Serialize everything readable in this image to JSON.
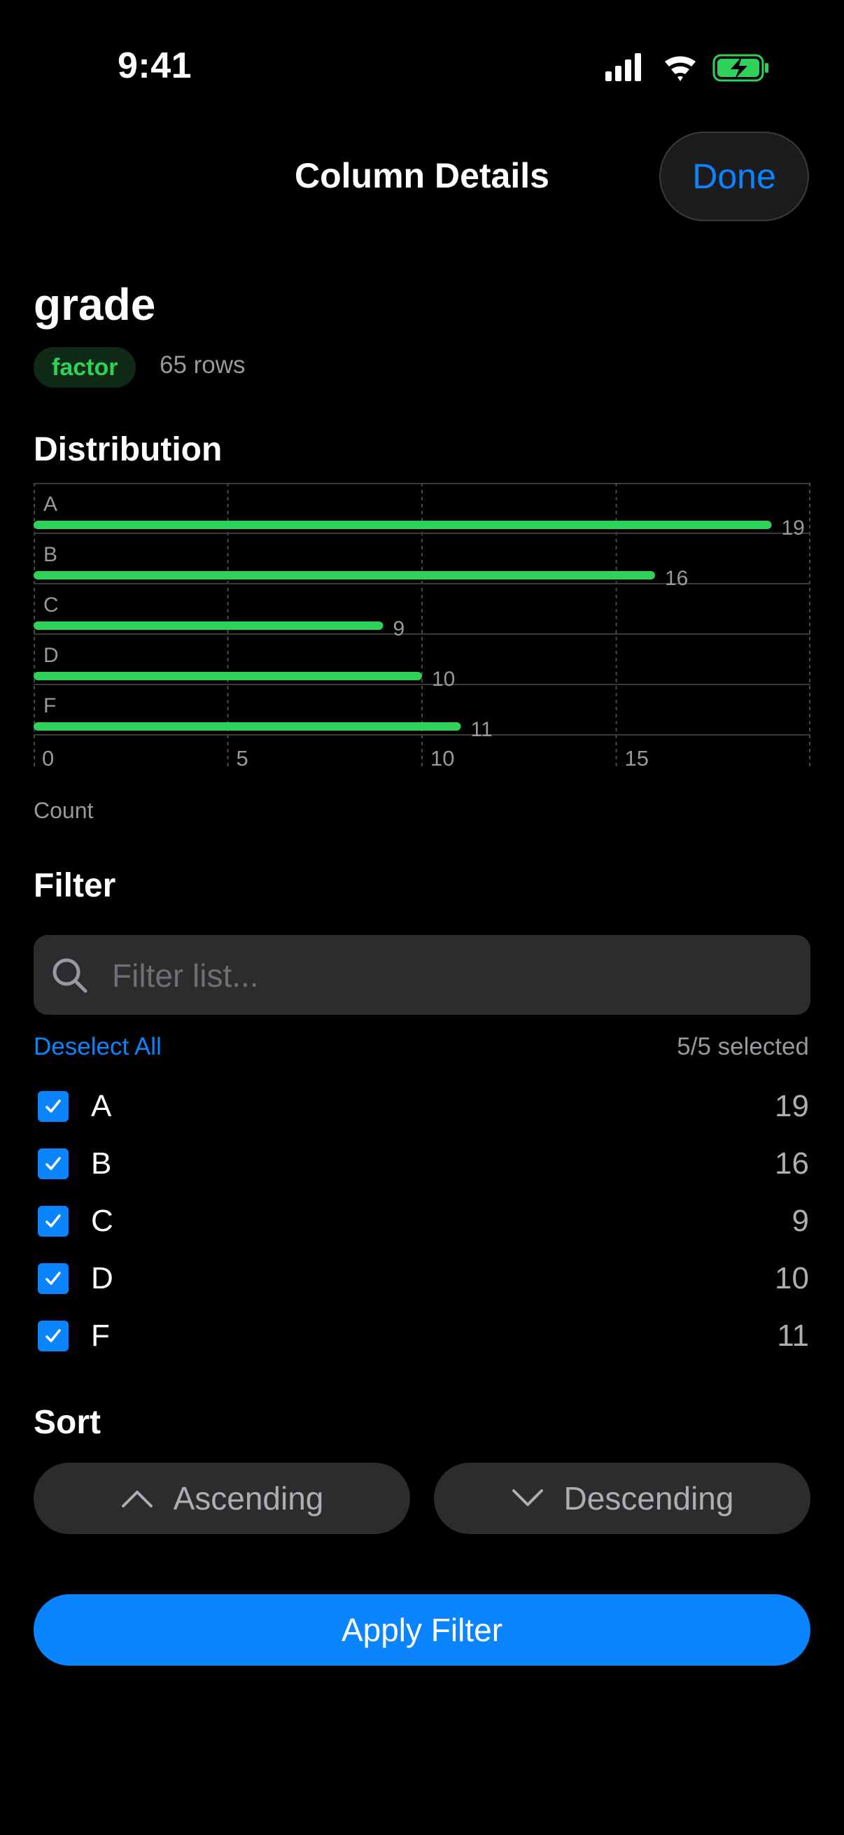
{
  "status_bar": {
    "time": "9:41"
  },
  "nav": {
    "title": "Column Details",
    "done_label": "Done"
  },
  "column": {
    "name": "grade",
    "type_badge": "factor",
    "rows_text": "65 rows"
  },
  "distribution": {
    "section_title": "Distribution"
  },
  "chart_data": {
    "type": "bar",
    "orientation": "horizontal",
    "categories": [
      "A",
      "B",
      "C",
      "D",
      "F"
    ],
    "values": [
      19,
      16,
      9,
      10,
      11
    ],
    "xlabel": "Count",
    "ylabel": "",
    "xlim": [
      0,
      20
    ],
    "x_ticks": [
      0,
      5,
      10,
      15
    ],
    "bar_color": "#30d158",
    "grid": true
  },
  "filter": {
    "section_title": "Filter",
    "search_placeholder": "Filter list...",
    "deselect_label": "Deselect All",
    "selected_text": "5/5 selected",
    "items": [
      {
        "label": "A",
        "count": "19",
        "checked": true
      },
      {
        "label": "B",
        "count": "16",
        "checked": true
      },
      {
        "label": "C",
        "count": "9",
        "checked": true
      },
      {
        "label": "D",
        "count": "10",
        "checked": true
      },
      {
        "label": "F",
        "count": "11",
        "checked": true
      }
    ]
  },
  "sort": {
    "section_title": "Sort",
    "ascending_label": "Ascending",
    "descending_label": "Descending"
  },
  "apply_label": "Apply Filter",
  "colors": {
    "accent": "#0a84ff",
    "success": "#30d158",
    "background": "#000000"
  }
}
